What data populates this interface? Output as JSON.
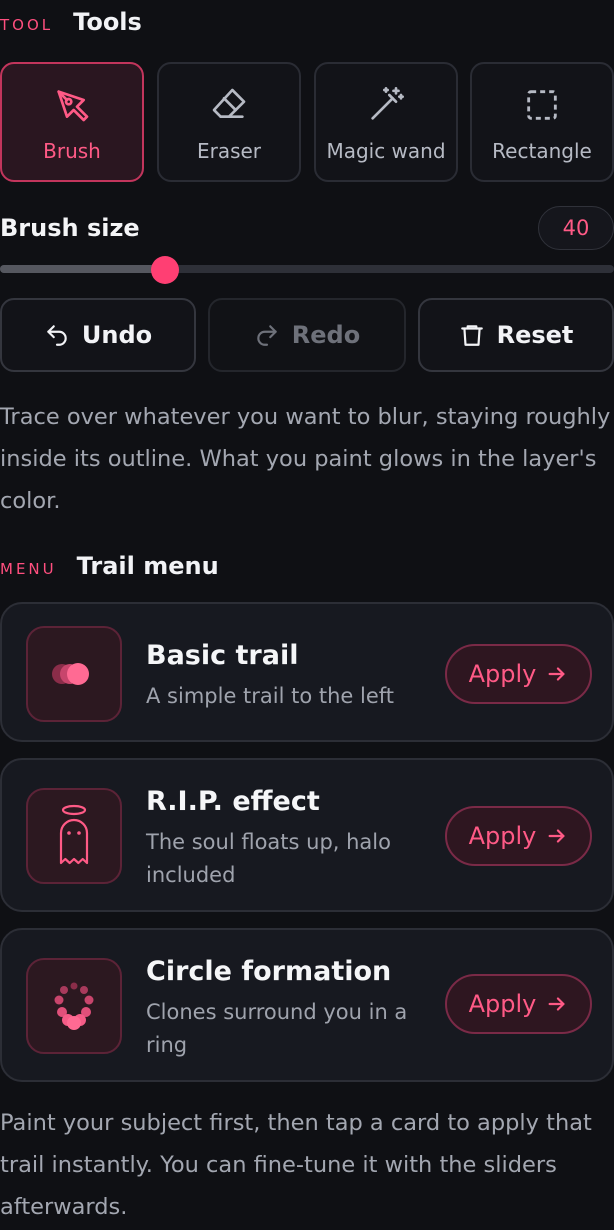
{
  "tools_section": {
    "tag": "TOOL",
    "title": "Tools"
  },
  "tools": [
    {
      "label": "Brush",
      "icon": "pen-nib-icon",
      "active": true
    },
    {
      "label": "Eraser",
      "icon": "eraser-icon",
      "active": false
    },
    {
      "label": "Magic wand",
      "icon": "magic-wand-icon",
      "active": false
    },
    {
      "label": "Rectangle",
      "icon": "rectangle-select-icon",
      "active": false
    }
  ],
  "brush": {
    "label": "Brush size",
    "value": "40",
    "slider_fraction": 0.268
  },
  "actions": {
    "undo_label": "Undo",
    "redo_label": "Redo",
    "reset_label": "Reset",
    "redo_disabled": true
  },
  "hint": "Trace over whatever you want to blur, staying roughly inside its outline. What you paint glows in the layer's color.",
  "menu_section": {
    "tag": "MENU",
    "title": "Trail menu"
  },
  "trails": [
    {
      "title": "Basic trail",
      "description": "A simple trail to the left",
      "apply_label": "Apply",
      "icon": "trail-dots-icon"
    },
    {
      "title": "R.I.P. effect",
      "description": "The soul floats up, halo included",
      "apply_label": "Apply",
      "icon": "ghost-halo-icon"
    },
    {
      "title": "Circle formation",
      "description": "Clones surround you in a ring",
      "apply_label": "Apply",
      "icon": "circle-formation-icon"
    }
  ],
  "footer_text": "Paint your subject first, then tap a card to apply that trail instantly. You can fine-tune it with the sliders afterwards.",
  "colors": {
    "accent": "#ff4f7f",
    "background": "#0f1014",
    "card": "#171920"
  }
}
